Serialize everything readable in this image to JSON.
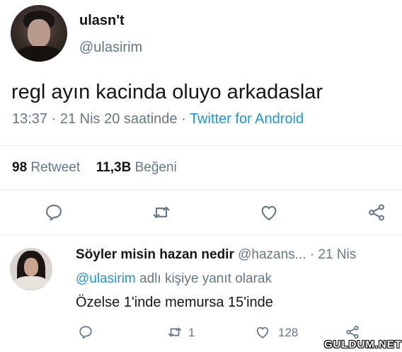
{
  "tweet": {
    "name": "ulasn't",
    "handle": "@ulasirim",
    "text": "regl ayın kacinda oluyo arkadaslar",
    "time": "13:37",
    "date": "21 Nis 20 saatinde",
    "source": "Twitter for Android",
    "retweet_count": "98",
    "retweet_label": "Retweet",
    "like_count": "11,3B",
    "like_label": "Beğeni"
  },
  "reply": {
    "name": "Söyler misin hazan nedir",
    "handle": "@hazans...",
    "date": "21 Nis",
    "replying_mention": "@ulasirim",
    "replying_text": "adlı kişiye yanıt olarak",
    "text": "Özelse 1'inde memursa 15'inde",
    "retweet_count": "1",
    "like_count": "128"
  },
  "watermark": "GULDUM.NET",
  "icons": [
    "reply-icon",
    "retweet-icon",
    "like-icon",
    "share-icon"
  ],
  "colors": {
    "link": "#1b95e0",
    "secondary": "#657786",
    "primary": "#14171a"
  }
}
